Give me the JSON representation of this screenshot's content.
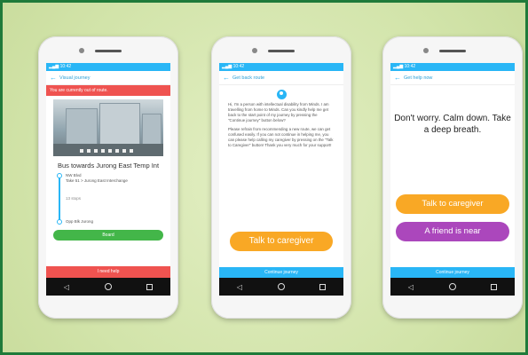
{
  "screen1": {
    "statusbar": "▂▄▆ 10:42",
    "title": "Visual journey",
    "alert": "You are currently out of route.",
    "route_title": "Bus towards Jurong East Temp Int",
    "stop1_line1": "NW Blvd",
    "stop1_line2": "Take 51 > Jurong East Interchange",
    "middle": "13 stops",
    "stop2": "Opp Blk Jurong",
    "green_button": "Board",
    "red_bar": "I need help"
  },
  "screen2": {
    "statusbar": "▂▄▆ 10:42",
    "title": "Get back route",
    "message_p1": "Hi, I'm a person with intellectual disability from Minds. I am travelling from home to Minds. Can you kindly help me get back to the start point of my journey by pressing the \"Continue journey\" button below?",
    "message_p2": "Please refrain from recommending a new route, we can get confused easily. If you can not continue in helping me, you can please help calling my caregiver by pressing on the \"Talk to Caregiver\" button! Thank you very much for your support!",
    "button": "Talk to caregiver",
    "bottom_bar": "Continue journey"
  },
  "screen3": {
    "statusbar": "▂▄▆ 10:42",
    "title": "Get help now",
    "calm_text": "Don't worry. Calm down. Take a deep breath.",
    "btn_caregiver": "Talk to caregiver",
    "btn_friend": "A friend is near",
    "bottom_bar": "Continue journey"
  },
  "nav": {
    "back": "◁",
    "home": "",
    "recent": ""
  }
}
